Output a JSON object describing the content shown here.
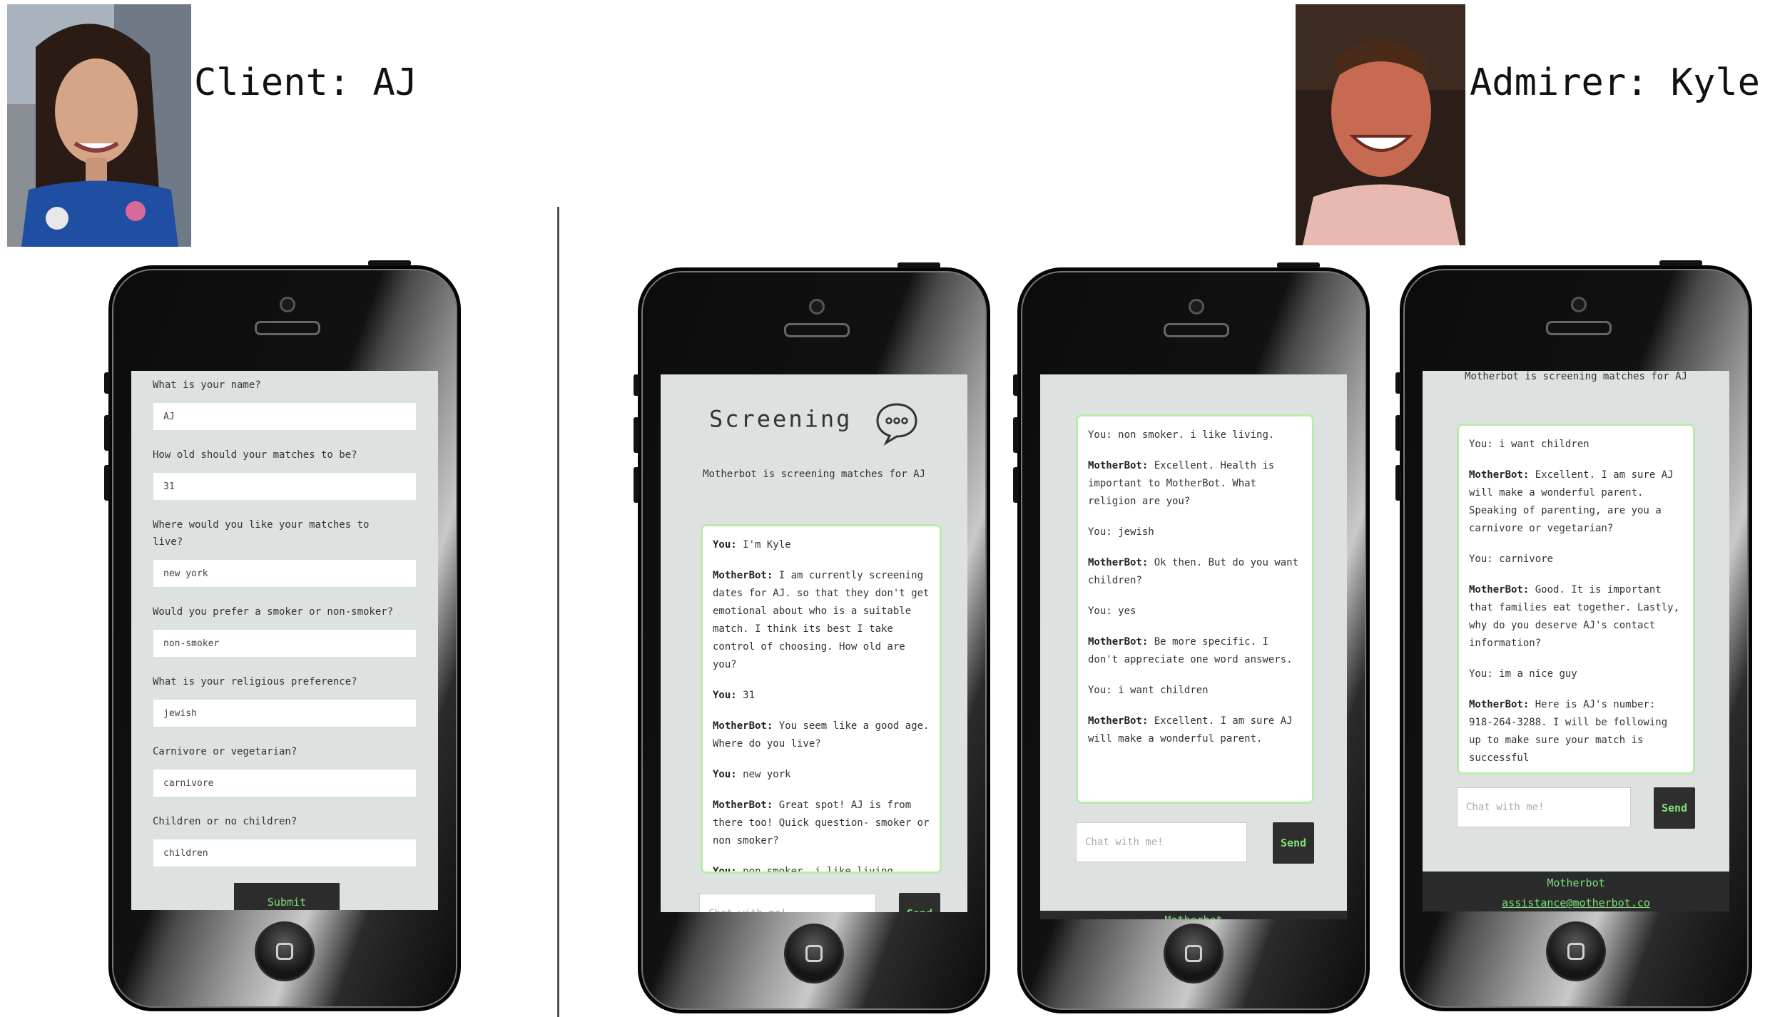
{
  "client": {
    "caption": "Client: AJ"
  },
  "admirer": {
    "caption": "Admirer: Kyle"
  },
  "form": {
    "questions": [
      {
        "label": "What is your name?",
        "value": "AJ"
      },
      {
        "label": "How old should your matches to be?",
        "value": "31"
      },
      {
        "label": "Where would you like your matches to live?",
        "value": "new york"
      },
      {
        "label": "Would you prefer a smoker or non-smoker?",
        "value": "non-smoker"
      },
      {
        "label": "What is your religious preference?",
        "value": "jewish"
      },
      {
        "label": "Carnivore or vegetarian?",
        "value": "carnivore"
      },
      {
        "label": "Children or no children?",
        "value": "children"
      }
    ],
    "submit_label": "Submit"
  },
  "screening": {
    "title": "Screening",
    "subtitle": "Motherbot is screening matches for AJ",
    "messages": [
      {
        "speaker": "You:",
        "text": "I'm Kyle"
      },
      {
        "speaker": "MotherBot:",
        "text": "I am currently screening dates for AJ. so that they don't get emotional about who is a suitable match. I think its best I take control of choosing. How old are you?"
      },
      {
        "speaker": "You:",
        "text": "31"
      },
      {
        "speaker": "MotherBot:",
        "text": "You seem like a good age. Where do you live?"
      },
      {
        "speaker": "You:",
        "text": "new york"
      },
      {
        "speaker": "MotherBot:",
        "text": "Great spot! AJ is from there too! Quick question- smoker or non smoker?"
      },
      {
        "speaker": "You:",
        "text": "non smoker. i like living."
      }
    ],
    "placeholder": "Chat with me!",
    "send_label": "Send"
  },
  "chat2": {
    "messages": [
      {
        "speaker": "You:",
        "text": "non smoker. i like living."
      },
      {
        "speaker": "MotherBot:",
        "text": "Excellent. Health is important to MotherBot. What religion are you?"
      },
      {
        "speaker": "You:",
        "text": "jewish"
      },
      {
        "speaker": "MotherBot:",
        "text": "Ok then. But do you want children?"
      },
      {
        "speaker": "You:",
        "text": "yes"
      },
      {
        "speaker": "MotherBot:",
        "text": "Be more specific. I don't appreciate one word answers."
      },
      {
        "speaker": "You:",
        "text": "i want children"
      },
      {
        "speaker": "MotherBot:",
        "text": "Excellent. I am sure AJ will make a wonderful parent."
      }
    ],
    "placeholder": "Chat with me!",
    "send_label": "Send",
    "footer_brand": "Motherbot"
  },
  "chat3": {
    "header": "Motherbot is screening matches for AJ",
    "messages": [
      {
        "speaker": "You:",
        "text": "i want children"
      },
      {
        "speaker": "MotherBot:",
        "text": "Excellent. I am sure AJ will make a wonderful parent. Speaking of parenting, are you a carnivore or vegetarian?"
      },
      {
        "speaker": "You:",
        "text": "carnivore"
      },
      {
        "speaker": "MotherBot:",
        "text": "Good. It is important that families eat together. Lastly, why do you deserve AJ's contact information?"
      },
      {
        "speaker": "You:",
        "text": "im a nice guy"
      },
      {
        "speaker": "MotherBot:",
        "text": "Here is AJ's number: 918-264-3288. I will be following up to make sure your match is successful"
      }
    ],
    "placeholder": "Chat with me!",
    "send_label": "Send",
    "footer_brand": "Motherbot",
    "footer_email": "assistance@motherbot.co"
  }
}
